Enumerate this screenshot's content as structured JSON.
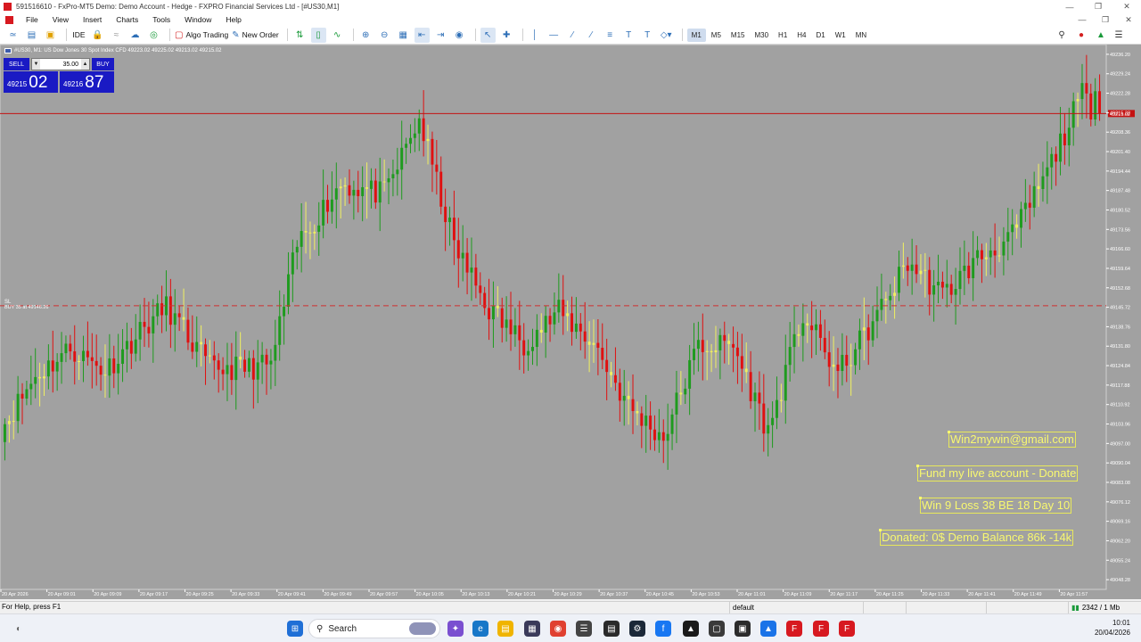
{
  "window": {
    "title": "591516610 - FxPro-MT5 Demo: Demo Account - Hedge - FXPRO Financial Services Ltd - [#US30,M1]"
  },
  "menu": {
    "items": [
      "File",
      "View",
      "Insert",
      "Charts",
      "Tools",
      "Window",
      "Help"
    ]
  },
  "toolbar": {
    "ide_label": "IDE",
    "algo_trading_label": "Algo Trading",
    "new_order_label": "New Order",
    "timeframes": [
      "M1",
      "M5",
      "M15",
      "M30",
      "H1",
      "H4",
      "D1",
      "W1",
      "MN"
    ],
    "active_timeframe": "M1"
  },
  "chart": {
    "header": "#US30, M1: US Dow Jones 30 Spot Index CFD  49223.02 49225.02 49213.02 49215.02",
    "sl_label": "SL",
    "position_label": "BUY 35 at 49146.26",
    "current_price_label": "49215.02",
    "trade_panel": {
      "sell_label": "SELL",
      "buy_label": "BUY",
      "volume": "35.00",
      "bid_small": "49215",
      "bid_big": "02",
      "ask_small": "49216",
      "ask_big": "87"
    },
    "annotations": [
      "Win2mywin@gmail.com",
      "Fund my live account - Donate",
      "Win 9  Loss 38  BE 18  Day 10",
      "Donated: 0$  Demo Balance 86k -14k"
    ],
    "colors": {
      "background": "#a1a1a1",
      "bull": "#1e9b1e",
      "bear": "#e01010",
      "doji": "#f0f060",
      "price_line": "#c41212",
      "sl_line": "#d03030",
      "annotation": "#f8f870"
    }
  },
  "chart_data": {
    "type": "candlestick",
    "symbol": "#US30",
    "timeframe": "M1",
    "y_ticks": [
      "49236.20",
      "49229.24",
      "49222.28",
      "49215.32",
      "49208.36",
      "49201.40",
      "49194.44",
      "49187.48",
      "49180.52",
      "49173.56",
      "49166.60",
      "49159.64",
      "49152.68",
      "49145.72",
      "49138.76",
      "49131.80",
      "49124.84",
      "49117.88",
      "49110.92",
      "49103.96",
      "49097.00",
      "49090.04",
      "49083.08",
      "49076.12",
      "49069.16",
      "49062.20",
      "49055.24",
      "49048.28"
    ],
    "x_ticks": [
      "20 Apr 2026",
      "20 Apr 09:01",
      "20 Apr 09:09",
      "20 Apr 09:17",
      "20 Apr 09:25",
      "20 Apr 09:33",
      "20 Apr 09:41",
      "20 Apr 09:49",
      "20 Apr 09:57",
      "20 Apr 10:05",
      "20 Apr 10:13",
      "20 Apr 10:21",
      "20 Apr 10:29",
      "20 Apr 10:37",
      "20 Apr 10:45",
      "20 Apr 10:53",
      "20 Apr 11:01",
      "20 Apr 11:09",
      "20 Apr 11:17",
      "20 Apr 11:25",
      "20 Apr 11:33",
      "20 Apr 11:41",
      "20 Apr 11:49",
      "20 Apr 11:57"
    ],
    "ylim": [
      49044.8,
      49239.68
    ],
    "current_price": 49215.02,
    "sl_price": 49146.26,
    "open_anchors": [
      [
        0,
        49102
      ],
      [
        8,
        49121
      ],
      [
        16,
        49131
      ],
      [
        24,
        49123
      ],
      [
        32,
        49137
      ],
      [
        38,
        49146
      ],
      [
        48,
        49124
      ],
      [
        56,
        49124
      ],
      [
        62,
        49125
      ],
      [
        68,
        49168
      ],
      [
        78,
        49190
      ],
      [
        88,
        49186
      ],
      [
        96,
        49213
      ],
      [
        104,
        49168
      ],
      [
        112,
        49145
      ],
      [
        120,
        49133
      ],
      [
        128,
        49144
      ],
      [
        136,
        49133
      ],
      [
        144,
        49110
      ],
      [
        152,
        49099
      ],
      [
        160,
        49132
      ],
      [
        168,
        49132
      ],
      [
        176,
        49101
      ],
      [
        184,
        49143
      ],
      [
        192,
        49122
      ],
      [
        200,
        49140
      ],
      [
        208,
        49162
      ],
      [
        216,
        49150
      ],
      [
        224,
        49163
      ],
      [
        232,
        49171
      ],
      [
        240,
        49194
      ],
      [
        248,
        49222
      ],
      [
        251,
        49215
      ]
    ]
  },
  "statusbar": {
    "help": "For Help, press F1",
    "profile": "default",
    "traffic": "2342 / 1 Mb"
  },
  "taskbar": {
    "search_placeholder": "Search",
    "time": "10:01",
    "date": "20/04/2026"
  }
}
